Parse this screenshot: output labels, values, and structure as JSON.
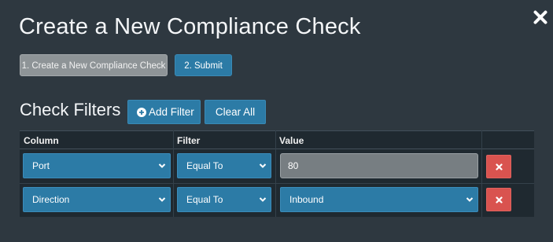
{
  "dialog": {
    "title": "Create a New Compliance Check",
    "close_icon": "close-icon"
  },
  "steps": [
    {
      "label": "1. Create a New Compliance Check",
      "state": "current",
      "color": "#8e9497"
    },
    {
      "label": "2. Submit",
      "state": "next",
      "color": "#2c7ba6"
    }
  ],
  "check_filters": {
    "heading": "Check Filters",
    "add_filter_label": "Add Filter",
    "add_filter_icon": "plus-circle-icon",
    "clear_all_label": "Clear All",
    "columns": [
      "Column",
      "Filter",
      "Value"
    ],
    "rows": [
      {
        "column": "Port",
        "filter": "Equal To",
        "value": "80",
        "value_type": "text-input"
      },
      {
        "column": "Direction",
        "filter": "Equal To",
        "value": "Inbound",
        "value_type": "select"
      }
    ],
    "delete_icon": "times-icon"
  },
  "colors": {
    "background": "#2e3840",
    "table_background": "#1f2930",
    "primary": "#2c7ba6",
    "danger": "#d9534f",
    "muted": "#8e9497"
  }
}
